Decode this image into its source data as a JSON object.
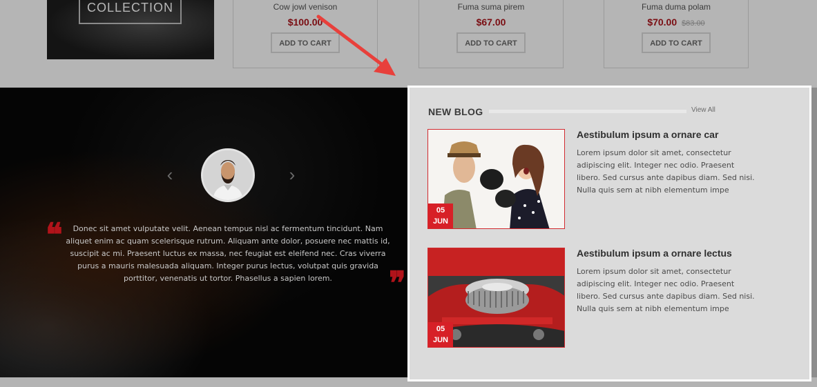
{
  "collection": {
    "label": "COLLECTION"
  },
  "products": [
    {
      "name": "Cow jowl venison",
      "price": "$100.00",
      "old_price": "",
      "cart_label": "ADD TO CART"
    },
    {
      "name": "Fuma suma pirem",
      "price": "$67.00",
      "old_price": "",
      "cart_label": "ADD TO CART"
    },
    {
      "name": "Fuma duma polam",
      "price": "$70.00",
      "old_price": "$83.00",
      "cart_label": "ADD TO CART"
    }
  ],
  "testimonial": {
    "prev_icon": "chevron-left-icon",
    "next_icon": "chevron-right-icon",
    "open_quote": "❝",
    "close_quote": "❞",
    "text": "Donec sit amet vulputate velit. Aenean tempus nisl ac fermentum tincidunt. Nam aliquet enim ac quam scelerisque rutrum. Aliquam ante dolor, posuere nec mattis id, suscipit ac mi. Praesent luctus ex massa, nec feugiat est eleifend nec. Cras viverra purus a mauris malesuada aliquam. Integer purus lectus, volutpat quis gravida porttitor, venenatis ut tortor. Phasellus a sapien lorem."
  },
  "blog": {
    "title": "NEW BLOG",
    "view_all": "View All",
    "posts": [
      {
        "title": "Aestibulum ipsum a ornare car",
        "excerpt": "Lorem ipsum dolor sit amet, consectetur adipiscing elit. Integer nec odio. Praesent libero. Sed cursus ante dapibus diam. Sed nisi. Nulla quis sem at nibh elementum impe",
        "day": "05",
        "month": "JUN"
      },
      {
        "title": "Aestibulum ipsum a ornare lectus",
        "excerpt": "Lorem ipsum dolor sit amet, consectetur adipiscing elit. Integer nec odio. Praesent libero. Sed cursus ante dapibus diam. Sed nisi. Nulla quis sem at nibh elementum impe",
        "day": "05",
        "month": "JUN"
      }
    ]
  },
  "colors": {
    "accent": "#d72027",
    "overlay": "#000000",
    "annotation_arrow": "#e8403b"
  }
}
